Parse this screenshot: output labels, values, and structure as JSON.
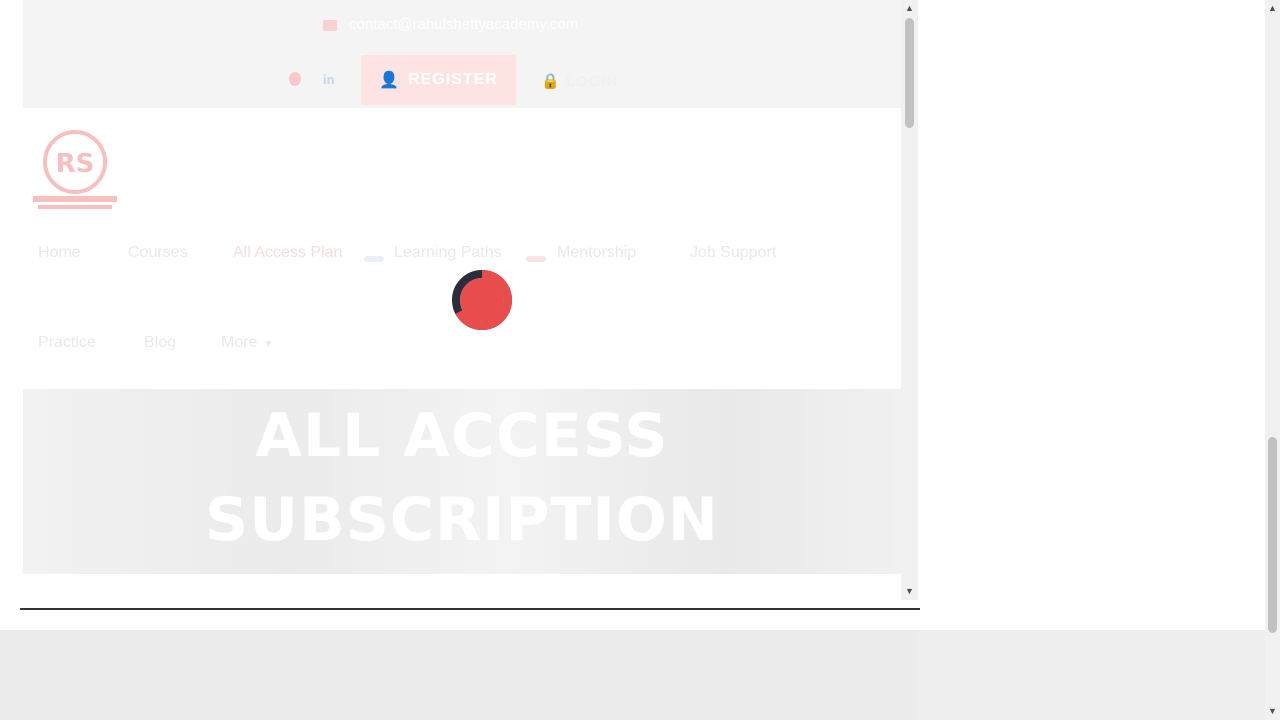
{
  "topbar": {
    "email": "contact@rahulshettyacademy.com",
    "register_label": "REGISTER",
    "login_label": "LOGIN"
  },
  "nav": {
    "row1": [
      "Home",
      "Courses",
      "All Access Plan",
      "Learning Paths",
      "Mentorship",
      "Job Support"
    ],
    "row2": [
      "Practice",
      "Blog",
      "More"
    ]
  },
  "hero": {
    "line1": "ALL ACCESS",
    "line2": "SUBSCRIPTION"
  },
  "colors": {
    "accent": "#e84c4c",
    "loader_dark": "#2b2d3a"
  },
  "icons": [
    "mail-icon",
    "pinterest-icon",
    "linkedin-icon",
    "user-icon",
    "chevron-down-icon",
    "loading-spinner-icon"
  ]
}
